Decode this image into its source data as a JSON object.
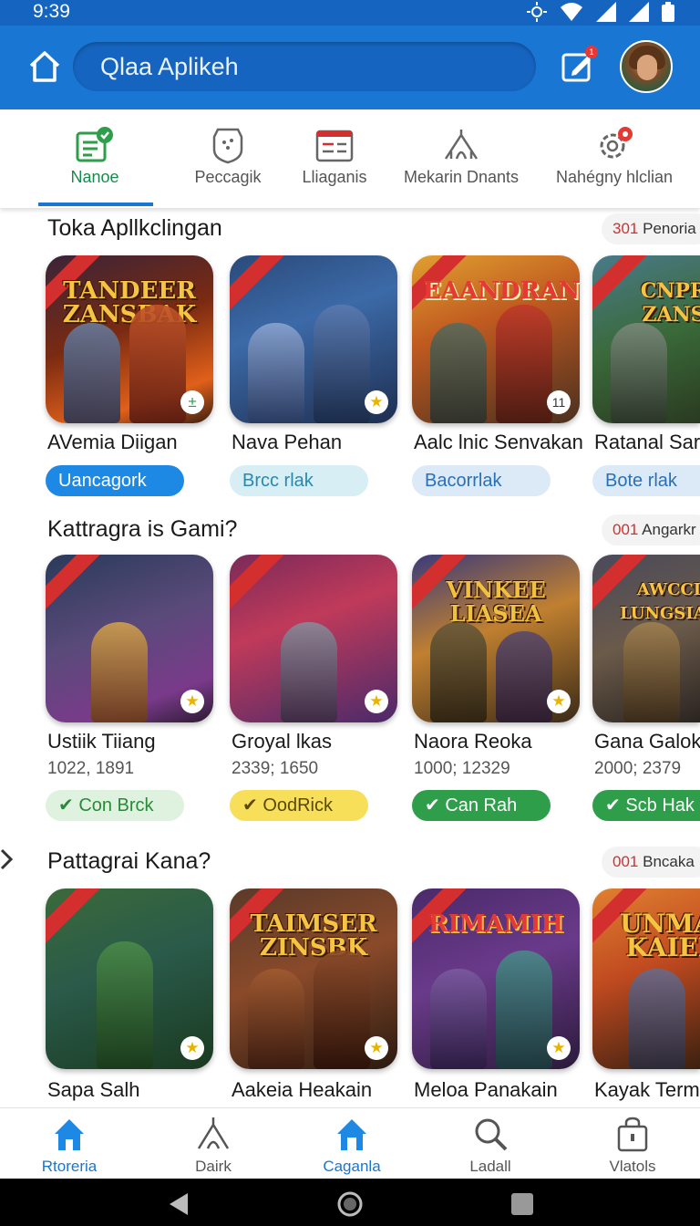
{
  "status": {
    "time": "9:39"
  },
  "appbar": {
    "search_text": "Qlaa Aplikeh",
    "notif_badge": "1"
  },
  "categories": [
    {
      "label": "Nanoe",
      "icon": "clipboard-check-icon",
      "active": true
    },
    {
      "label": "Peccagik",
      "icon": "shield-dots-icon",
      "active": false
    },
    {
      "label": "Lliaganis",
      "icon": "list-window-icon",
      "active": false
    },
    {
      "label": "Mekarin Dnants",
      "icon": "tent-icon",
      "active": false
    },
    {
      "label": "Nahégny hlclian",
      "icon": "gear-badge-icon",
      "active": false
    }
  ],
  "sections": [
    {
      "title": "Toka Apllkclingan",
      "pill_num": "301",
      "pill_text": "Penoria",
      "cards": [
        {
          "name": "AVemia Diigan",
          "logo": "TANDEER ZANSBAK",
          "badge": "±",
          "chip": "Uancagork",
          "chip_style": "blue"
        },
        {
          "name": "Nava Pehan",
          "logo": "",
          "badge": "★",
          "chip": "Brcc rlak",
          "chip_style": "light-teal"
        },
        {
          "name": "Aalc lnic Senvakan",
          "logo": "EAANDRAN",
          "badge": "11",
          "chip": "Bacorrlak",
          "chip_style": "light-blue"
        },
        {
          "name": "Ratanal Sari",
          "logo": "CNPR ZANS",
          "badge": "",
          "chip": "Bote rlak",
          "chip_style": "light-blue"
        }
      ]
    },
    {
      "title": "Kattragra is Gami?",
      "pill_num": "001",
      "pill_text": "Angarkr",
      "cards": [
        {
          "name": "Ustiik Tiiang",
          "meta": "1022, 1891",
          "logo": "",
          "badge": "★",
          "chip": "✔ Con Brck",
          "chip_style": "light-green"
        },
        {
          "name": "Groyal lkas",
          "meta": "2339; 1650",
          "logo": "",
          "badge": "★",
          "chip": "✔ OodRick",
          "chip_style": "yellow"
        },
        {
          "name": "Naora Reoka",
          "meta": "1000; 12329",
          "logo": "VINKEE LIASEA",
          "badge": "★",
          "chip": "✔ Can Rah",
          "chip_style": "green"
        },
        {
          "name": "Gana Galoka",
          "meta": "2000; 2379",
          "logo": "AWCCI LUNGSIAR",
          "badge": "",
          "chip": "✔ Scb Hak",
          "chip_style": "green"
        }
      ]
    },
    {
      "title": "Pattagrai Kana?",
      "pill_num": "001",
      "pill_text": "Bncaka",
      "cards": [
        {
          "name": "Sapa Salh",
          "logo": "",
          "badge": "★"
        },
        {
          "name": "Aakeia Heakain",
          "logo": "TAIMSER ZINSBK",
          "badge": "★"
        },
        {
          "name": "Meloa Panakain",
          "logo": "RIMAMIH",
          "badge": "★"
        },
        {
          "name": "Kayak Terma",
          "logo": "UNMAY KAIEN",
          "badge": ""
        }
      ]
    }
  ],
  "bottom_nav": [
    {
      "label": "Rtoreria",
      "icon": "home-icon",
      "active": true
    },
    {
      "label": "Dairk",
      "icon": "tent-icon",
      "active": false
    },
    {
      "label": "Caganla",
      "icon": "home-outline-icon",
      "active": true
    },
    {
      "label": "Ladall",
      "icon": "search-icon",
      "active": false
    },
    {
      "label": "Vlatols",
      "icon": "bag-icon",
      "active": false
    }
  ],
  "colors": {
    "primary": "#1976d2",
    "primary_dark": "#1565c0",
    "accent_green": "#2e9e4a",
    "red": "#d32f2f"
  }
}
